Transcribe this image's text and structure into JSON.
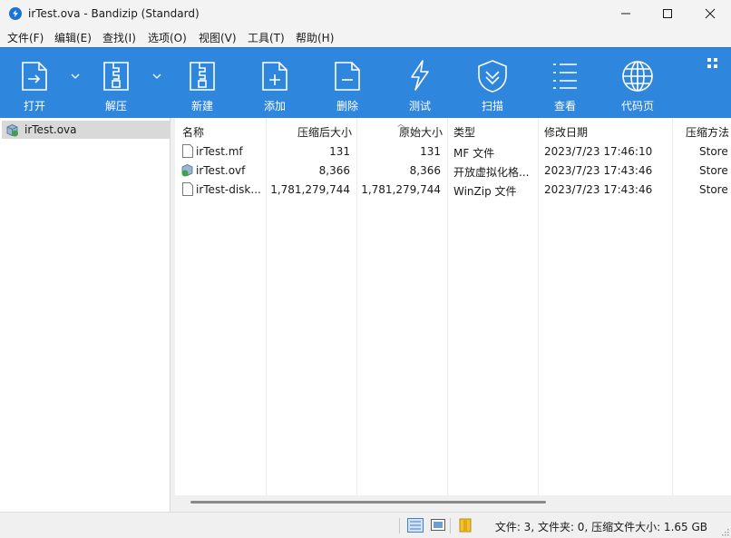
{
  "window": {
    "title": "irTest.ova - Bandizip (Standard)"
  },
  "menu": [
    "文件(F)",
    "编辑(E)",
    "查找(I)",
    "选项(O)",
    "视图(V)",
    "工具(T)",
    "帮助(H)"
  ],
  "toolbar": {
    "open": "打开",
    "extract": "解压",
    "new": "新建",
    "add": "添加",
    "delete": "删除",
    "test": "测试",
    "scan": "扫描",
    "view": "查看",
    "codepage": "代码页"
  },
  "tree": {
    "item": "irTest.ova"
  },
  "columns": [
    "名称",
    "压缩后大小",
    "原始大小",
    "类型",
    "修改日期",
    "压缩方法"
  ],
  "files": [
    {
      "name": "irTest.mf",
      "packed": "131",
      "size": "131",
      "type": "MF 文件",
      "modified": "2023/7/23  17:46:10",
      "method": "Store"
    },
    {
      "name": "irTest.ovf",
      "packed": "8,366",
      "size": "8,366",
      "type": "开放虚拟化格...",
      "modified": "2023/7/23  17:43:46",
      "method": "Store"
    },
    {
      "name": "irTest-disk...",
      "packed": "1,781,279,744",
      "size": "1,781,279,744",
      "type": "WinZip 文件",
      "modified": "2023/7/23  17:43:46",
      "method": "Store"
    }
  ],
  "status": {
    "summary": "文件: 3, 文件夹: 0, 压缩文件大小: 1.65 GB"
  },
  "colors": {
    "toolbar": "#2f86dd",
    "selection": "#d9d9d9",
    "accent": "#1a73d9"
  }
}
